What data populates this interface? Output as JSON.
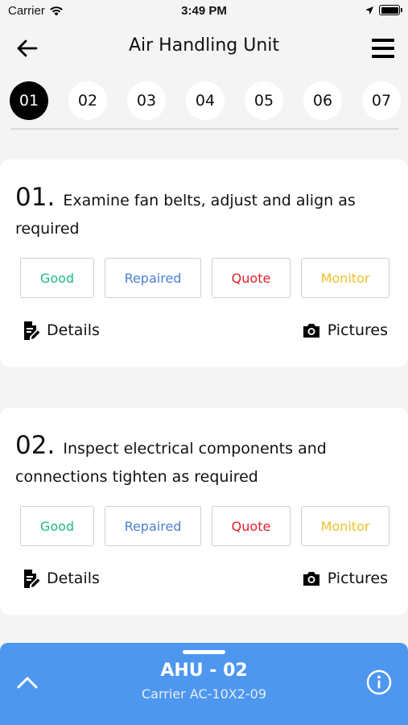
{
  "status_bar": {
    "carrier": "Carrier",
    "time": "3:49 PM"
  },
  "nav": {
    "title": "Air Handling Unit"
  },
  "steps": [
    "01",
    "02",
    "03",
    "04",
    "05",
    "06",
    "07"
  ],
  "active_step": "01",
  "tasks": [
    {
      "number": "01.",
      "description": "Examine fan belts, adjust and align as required",
      "options": {
        "good": "Good",
        "repaired": "Repaired",
        "quote": "Quote",
        "monitor": "Monitor"
      },
      "details_label": "Details",
      "pictures_label": "Pictures"
    },
    {
      "number": "02.",
      "description": "Inspect electrical components and connections tighten as required",
      "options": {
        "good": "Good",
        "repaired": "Repaired",
        "quote": "Quote",
        "monitor": "Monitor"
      },
      "details_label": "Details",
      "pictures_label": "Pictures"
    }
  ],
  "colors": {
    "good": "#1fb88c",
    "repaired": "#4a7fd3",
    "quote": "#e0202a",
    "monitor": "#ecc12a",
    "sheet": "#4d97ee"
  },
  "bottom_sheet": {
    "title": "AHU - 02",
    "subtitle": "Carrier AC-10X2-09"
  }
}
